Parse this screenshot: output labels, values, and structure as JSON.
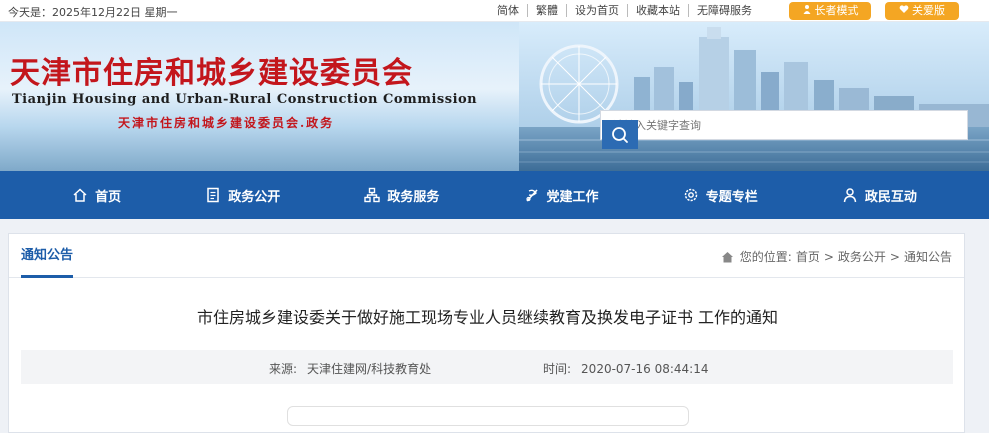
{
  "topbar": {
    "date": "今天是：2025年12月22日 星期一",
    "links": [
      "简体",
      "繁體",
      "设为首页",
      "收藏本站",
      "无障碍服务"
    ],
    "elder_mode": "长者模式",
    "care_mode": "关爱版"
  },
  "header": {
    "title": "天津市住房和城乡建设委员会",
    "title_en": "Tianjin Housing and Urban-Rural Construction Commission",
    "subtitle": "天津市住房和城乡建设委员会.政务",
    "search_placeholder": "请输入关键字查询"
  },
  "nav": {
    "items": [
      {
        "label": "首页",
        "icon": "home-icon"
      },
      {
        "label": "政务公开",
        "icon": "document-icon"
      },
      {
        "label": "政务服务",
        "icon": "org-chart-icon"
      },
      {
        "label": "党建工作",
        "icon": "party-flag-icon"
      },
      {
        "label": "专题专栏",
        "icon": "gear-icon"
      },
      {
        "label": "政民互动",
        "icon": "user-icon"
      }
    ]
  },
  "page": {
    "tab": "通知公告",
    "breadcrumb_prefix": "您的位置:",
    "breadcrumb": [
      "首页",
      "政务公开",
      "通知公告"
    ],
    "article_title": "市住房城乡建设委关于做好施工现场专业人员继续教育及换发电子证书 工作的通知",
    "source_label": "来源:",
    "source_value": "天津住建网/科技教育处",
    "time_label": "时间:",
    "time_value": "2020-07-16 08:44:14"
  },
  "colors": {
    "nav_blue": "#1d5da9",
    "title_red": "#c3161c",
    "accent_orange": "#f4a623"
  }
}
